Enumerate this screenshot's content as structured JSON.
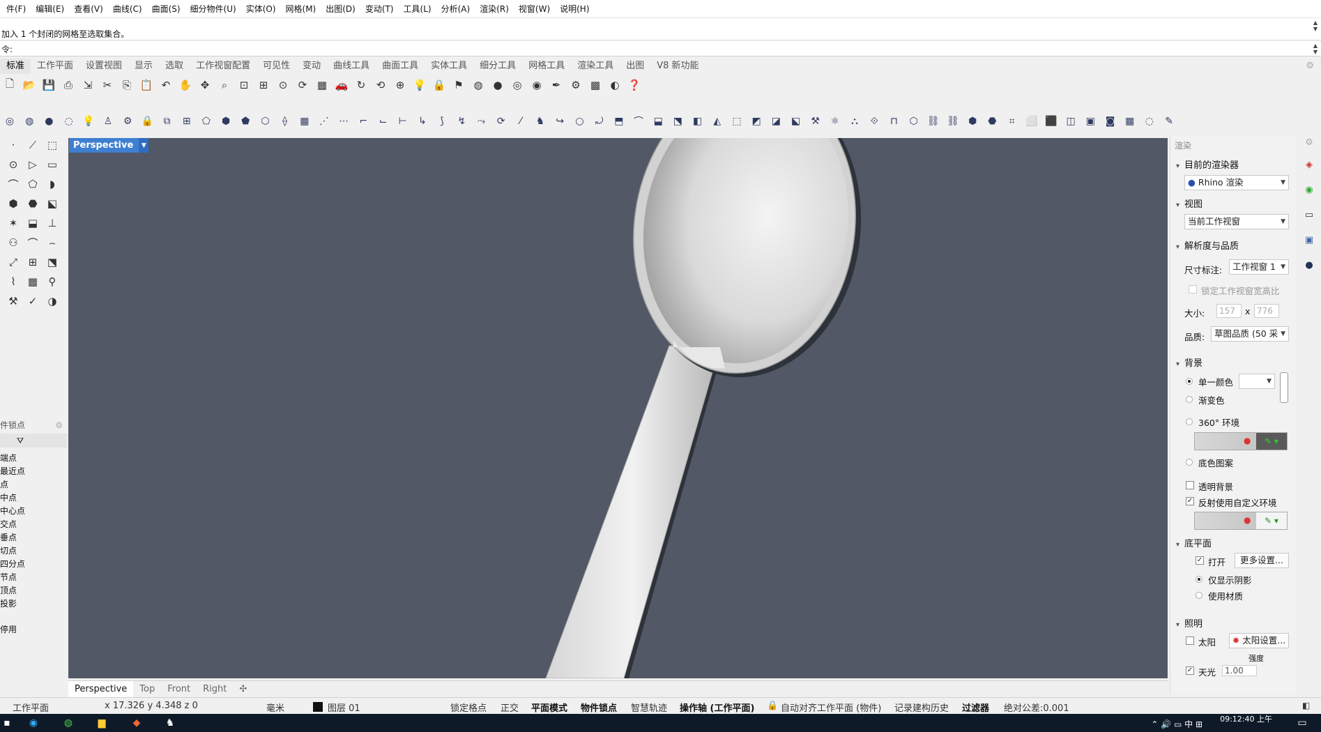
{
  "menu": [
    "件(F)",
    "编辑(E)",
    "查看(V)",
    "曲线(C)",
    "曲面(S)",
    "细分物件(U)",
    "实体(O)",
    "网格(M)",
    "出图(D)",
    "变动(T)",
    "工具(L)",
    "分析(A)",
    "渲染(R)",
    "视窗(W)",
    "说明(H)"
  ],
  "command": {
    "history_line": "加入 1 个封闭的网格至选取集合。",
    "prompt": "令:"
  },
  "toolbar_tabs": [
    "标准",
    "工作平面",
    "设置视图",
    "显示",
    "选取",
    "工作视窗配置",
    "可见性",
    "变动",
    "曲线工具",
    "曲面工具",
    "实体工具",
    "细分工具",
    "网格工具",
    "渲染工具",
    "出图",
    "V8 新功能"
  ],
  "toolbar1_icons": [
    "new-file-icon",
    "open-folder-icon",
    "save-icon",
    "print-icon",
    "import-icon",
    "cut-icon",
    "copy-icon",
    "paste-icon",
    "undo-icon",
    "pan-hand-icon",
    "move-icon",
    "zoom-icon",
    "zoom-window-icon",
    "zoom-extents-icon",
    "zoom-selected-icon",
    "rotate-view-icon",
    "four-view-icon",
    "car-icon",
    "rotate-2d-icon",
    "rotate-3d-icon",
    "gumball-icon",
    "light-bulb-icon",
    "lock-icon",
    "layer-icon",
    "color-wheel-icon",
    "sphere-shaded-icon",
    "sphere-wire-icon",
    "render-sphere-icon",
    "pen-icon",
    "gear-group-icon",
    "grid-icon",
    "globe-icon",
    "help-icon"
  ],
  "toolbar2_count": 60,
  "left_tools_count": 33,
  "osnap": {
    "header": "件锁点",
    "items": [
      "端点",
      "最近点",
      "点",
      "中点",
      "中心点",
      "交点",
      "垂点",
      "切点",
      "四分点",
      "节点",
      "顶点",
      "投影"
    ],
    "disable": "停用"
  },
  "viewport": {
    "label": "Perspective",
    "background": "#525865",
    "tabs": [
      "Perspective",
      "Top",
      "Front",
      "Right"
    ],
    "add_tab": "✣"
  },
  "render_panel": {
    "title": "渲染",
    "sec_renderer": "目前的渲染器",
    "renderer_value": "Rhino 渲染",
    "sec_view": "视图",
    "view_value": "当前工作视窗",
    "sec_resolution": "解析度与品质",
    "dimension_label": "尺寸标注:",
    "dimension_value": "工作视窗 1",
    "lock_ratio": "锁定工作视窗宽高比",
    "size_label": "大小:",
    "size_w": "157",
    "size_h": "776",
    "size_x": "x",
    "quality_label": "品质:",
    "quality_value": "草图品质 (50 采",
    "sec_background": "背景",
    "solid_color": "单一颜色",
    "gradient": "渐变色",
    "env360": "360° 环境",
    "wallpaper": "底色图案",
    "transparent_bg": "透明背景",
    "reflect_custom": "反射使用自定义环境",
    "sec_ground": "底平面",
    "ground_on": "打开",
    "more_settings": "更多设置...",
    "shadows_only": "仅显示阴影",
    "use_material": "使用材质",
    "sec_lighting": "照明",
    "sun": "太阳",
    "sun_settings": "太阳设置...",
    "intensity_label": "强度",
    "skylight": "天光",
    "skylight_value": "1.00"
  },
  "status": {
    "cplane": "工作平面",
    "coords": "x 17.326  y 4.348  z 0",
    "units": "毫米",
    "layer": "图层 01",
    "lock_grid": "锁定格点",
    "ortho": "正交",
    "planar": "平面模式",
    "osnap": "物件锁点",
    "smarttrack": "智慧轨迹",
    "gumball": "操作轴 (工作平面)",
    "auto_align": "自动对齐工作平面 (物件)",
    "history": "记录建构历史",
    "filter": "过滤器",
    "tolerance": "绝对公差:0.001"
  },
  "taskbar": {
    "time": "09:12:40 上午",
    "ime": "中"
  },
  "colors": {
    "viewport_bg": "#525865",
    "viewport_label_bg": "#3f7fd0"
  }
}
